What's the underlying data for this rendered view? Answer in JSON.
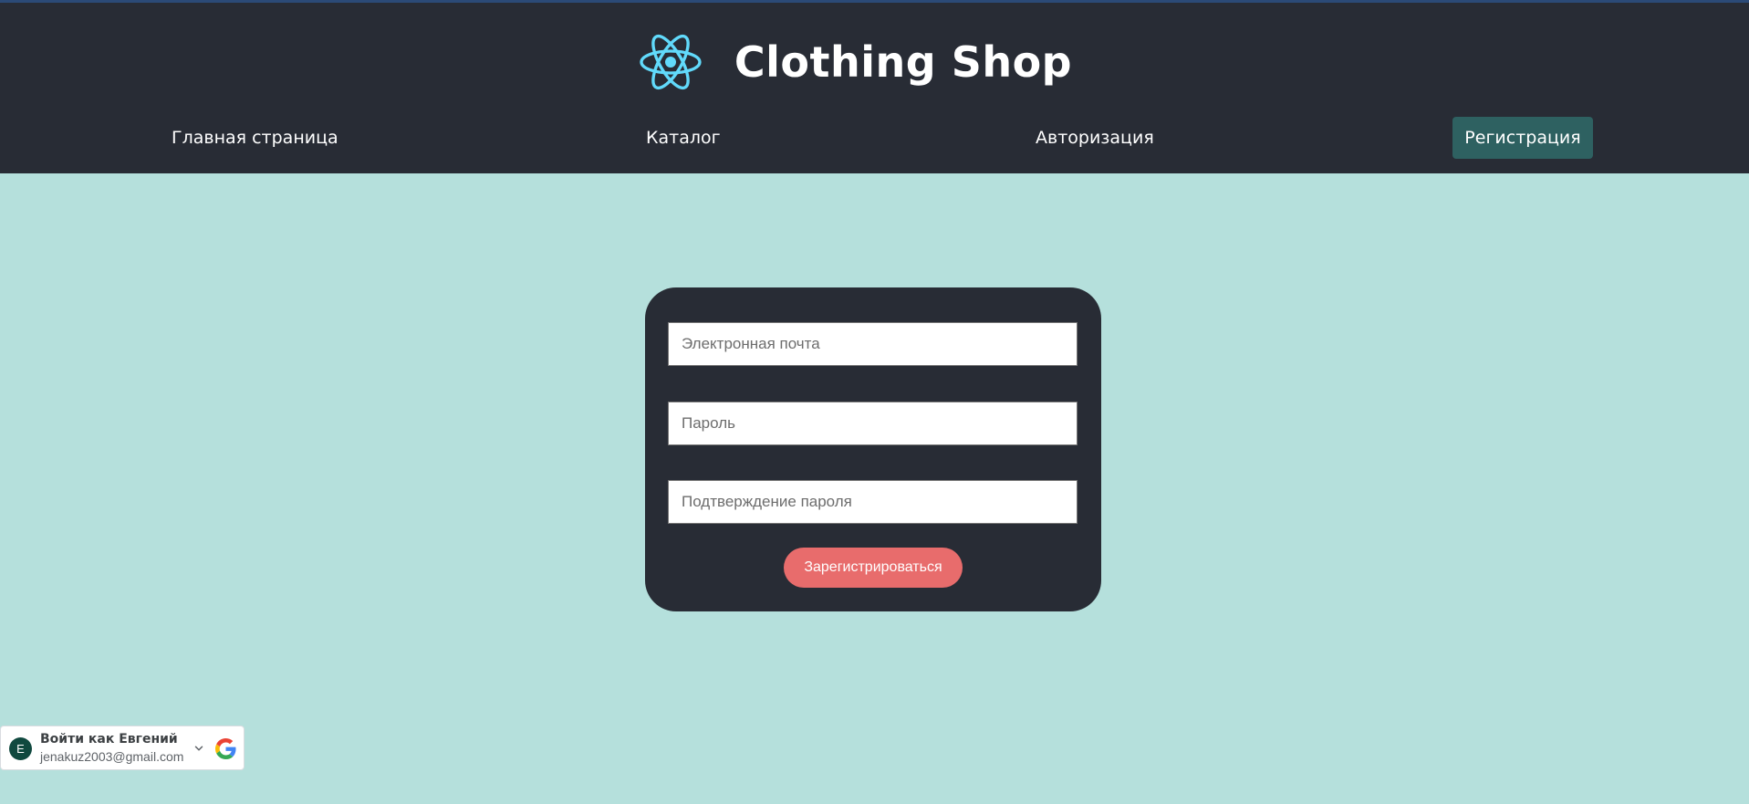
{
  "header": {
    "logo_icon": "react-atom-icon",
    "title": "Clothing Shop",
    "accent_color": "#61dafb"
  },
  "nav": {
    "home": "Главная страница",
    "catalog": "Каталог",
    "auth": "Авторизация",
    "register": "Регистрация"
  },
  "form": {
    "email_placeholder": "Электронная почта",
    "password_placeholder": "Пароль",
    "confirm_placeholder": "Подтверждение пароля",
    "submit_label": "Зарегистрироваться"
  },
  "google_signin": {
    "avatar_letter": "E",
    "name": "Войти как Евгений",
    "email": "jenakuz2003@gmail.com",
    "dropdown_icon": "chevron-down-icon",
    "logo_icon": "google-logo-icon"
  },
  "colors": {
    "header_bg": "#282c35",
    "page_bg": "#b5e0dc",
    "active_nav_bg": "#2e6161",
    "submit_bg": "#e86c6c"
  }
}
